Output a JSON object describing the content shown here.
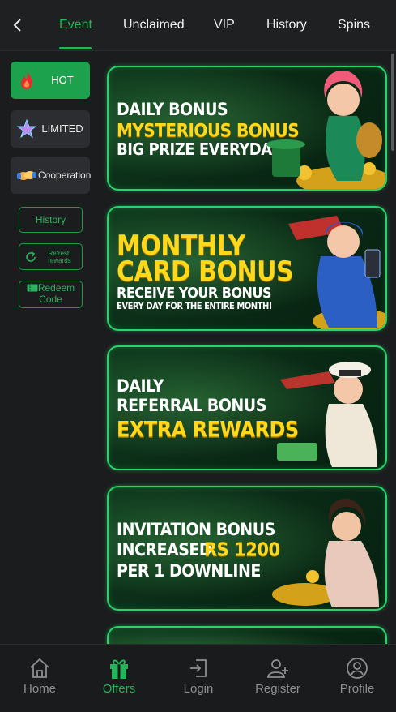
{
  "tabs": [
    {
      "label": "Event",
      "active": true
    },
    {
      "label": "Unclaimed",
      "active": false
    },
    {
      "label": "VIP",
      "active": false
    },
    {
      "label": "History",
      "active": false
    },
    {
      "label": "Spins",
      "active": false
    }
  ],
  "sidebar": {
    "categories": [
      {
        "label": "HOT",
        "icon": "flame-icon",
        "active": true
      },
      {
        "label": "LIMITED",
        "icon": "star-icon",
        "active": false
      },
      {
        "label": "Cooperation",
        "icon": "handshake-icon",
        "active": false
      }
    ],
    "history_label": "History",
    "refresh_label": "Refresh rewards",
    "redeem_label": "Redeem Code"
  },
  "banners": [
    {
      "lines": [
        "DAILY BONUS",
        "MYSTERIOUS BONUS",
        "BIG PRIZE EVERYDAY"
      ]
    },
    {
      "lines": [
        "MONTHLY",
        "CARD BONUS",
        "RECEIVE YOUR BONUS",
        "EVERY DAY FOR THE ENTIRE MONTH!"
      ]
    },
    {
      "lines": [
        "DAILY",
        "REFERRAL BONUS",
        "EXTRA REWARDS"
      ]
    },
    {
      "lines": [
        "INVITATION BONUS",
        "INCREASED",
        "RS 1200",
        "PER 1 DOWNLINE"
      ]
    }
  ],
  "bottom_nav": [
    {
      "label": "Home",
      "icon": "home-icon",
      "active": false
    },
    {
      "label": "Offers",
      "icon": "gift-icon",
      "active": true
    },
    {
      "label": "Login",
      "icon": "login-icon",
      "active": false
    },
    {
      "label": "Register",
      "icon": "add-user-icon",
      "active": false
    },
    {
      "label": "Profile",
      "icon": "profile-icon",
      "active": false
    }
  ],
  "colors": {
    "accent": "#27b35a",
    "gold": "#ffd81c",
    "background": "#1b1c1e"
  }
}
